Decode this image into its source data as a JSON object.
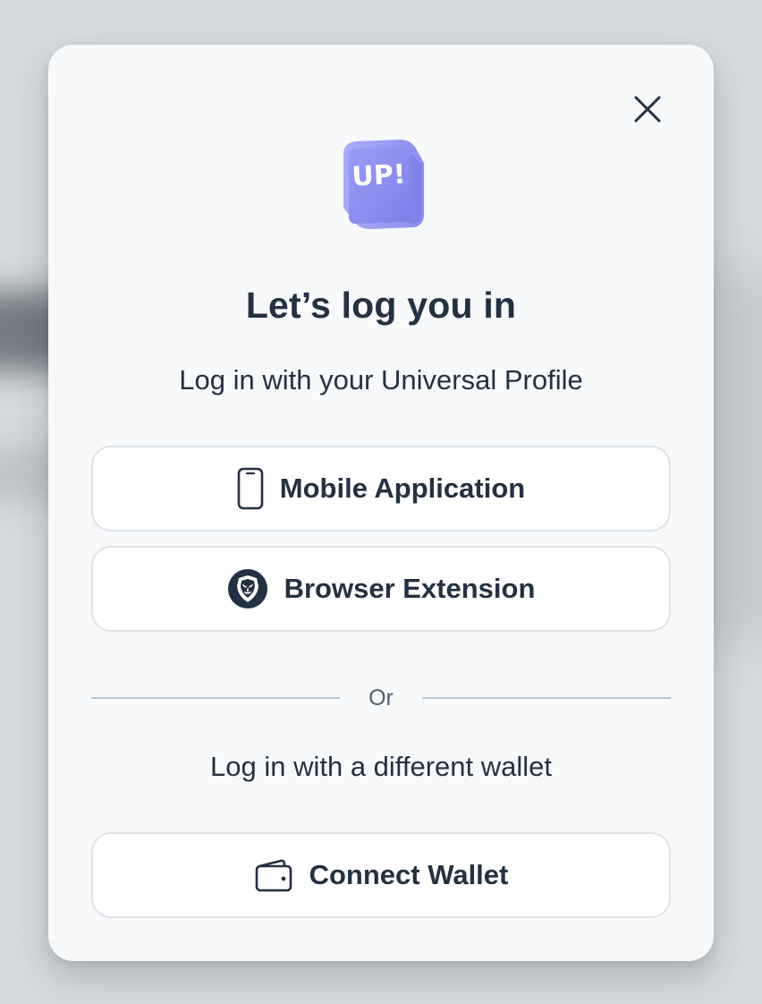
{
  "modal": {
    "title": "Let’s log you in",
    "subtitle": "Log in with your Universal Profile",
    "logo_text": "UP!",
    "close_icon": "close-icon"
  },
  "options": {
    "mobile": {
      "label": "Mobile Application",
      "icon": "phone-icon"
    },
    "browser": {
      "label": "Browser Extension",
      "icon": "lion-shield-icon"
    }
  },
  "divider": {
    "label": "Or"
  },
  "alternative": {
    "text": "Log in with a different wallet",
    "wallet": {
      "label": "Connect Wallet",
      "icon": "wallet-icon"
    }
  },
  "colors": {
    "text_primary": "#243142",
    "modal_bg": "#f7f9fb",
    "logo_purple": "#8f8ff2",
    "border": "#dde3e8"
  }
}
